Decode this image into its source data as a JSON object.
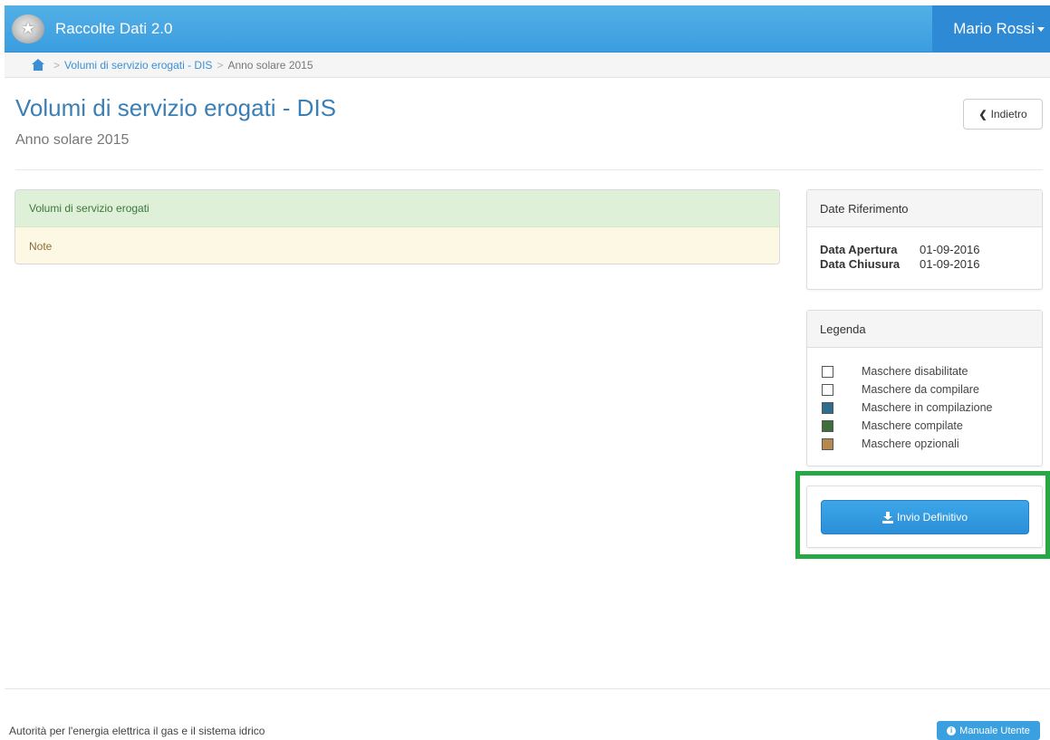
{
  "navbar": {
    "app_title": "Raccolte Dati 2.0",
    "user_name": "Mario Rossi",
    "logo_icon": "emblem-icon",
    "background_color": "#3b9de0"
  },
  "breadcrumb": {
    "home_icon": "home-icon",
    "separator": ">",
    "items": [
      {
        "label": "Volumi di servizio erogati - DIS"
      },
      {
        "label": "Anno solare 2015"
      }
    ]
  },
  "header": {
    "title": "Volumi di servizio erogati - DIS",
    "subtitle": "Anno solare 2015",
    "back_label": "Indietro",
    "back_icon": "chevron-left-icon"
  },
  "main_panel": {
    "rows": [
      {
        "label": "Volumi di servizio erogati",
        "color": "#dff0d8"
      },
      {
        "label": "Note",
        "color": "#fcf8e3"
      }
    ]
  },
  "date_panel": {
    "heading": "Date Riferimento",
    "rows": [
      {
        "label": "Data Apertura",
        "value": "01-09-2016"
      },
      {
        "label": "Data Chiusura",
        "value": "01-09-2016"
      }
    ]
  },
  "legend_panel": {
    "heading": "Legenda",
    "items": [
      {
        "label": "Maschere disabilitate",
        "color": "#ffffff"
      },
      {
        "label": "Maschere da compilare",
        "color": "#ffffff"
      },
      {
        "label": "Maschere in compilazione",
        "color": "#2f6d8f"
      },
      {
        "label": "Maschere compilate",
        "color": "#3d6e3b"
      },
      {
        "label": "Maschere opzionali",
        "color": "#b5894e"
      }
    ]
  },
  "send_panel": {
    "button_label": "Invio Definitivo",
    "button_icon": "download-icon",
    "highlight_color": "#28a745"
  },
  "footer": {
    "text": "Autorità per l'energia elettrica il gas e il sistema idrico",
    "manual_label": "Manuale Utente",
    "manual_icon": "info-circle-icon"
  }
}
